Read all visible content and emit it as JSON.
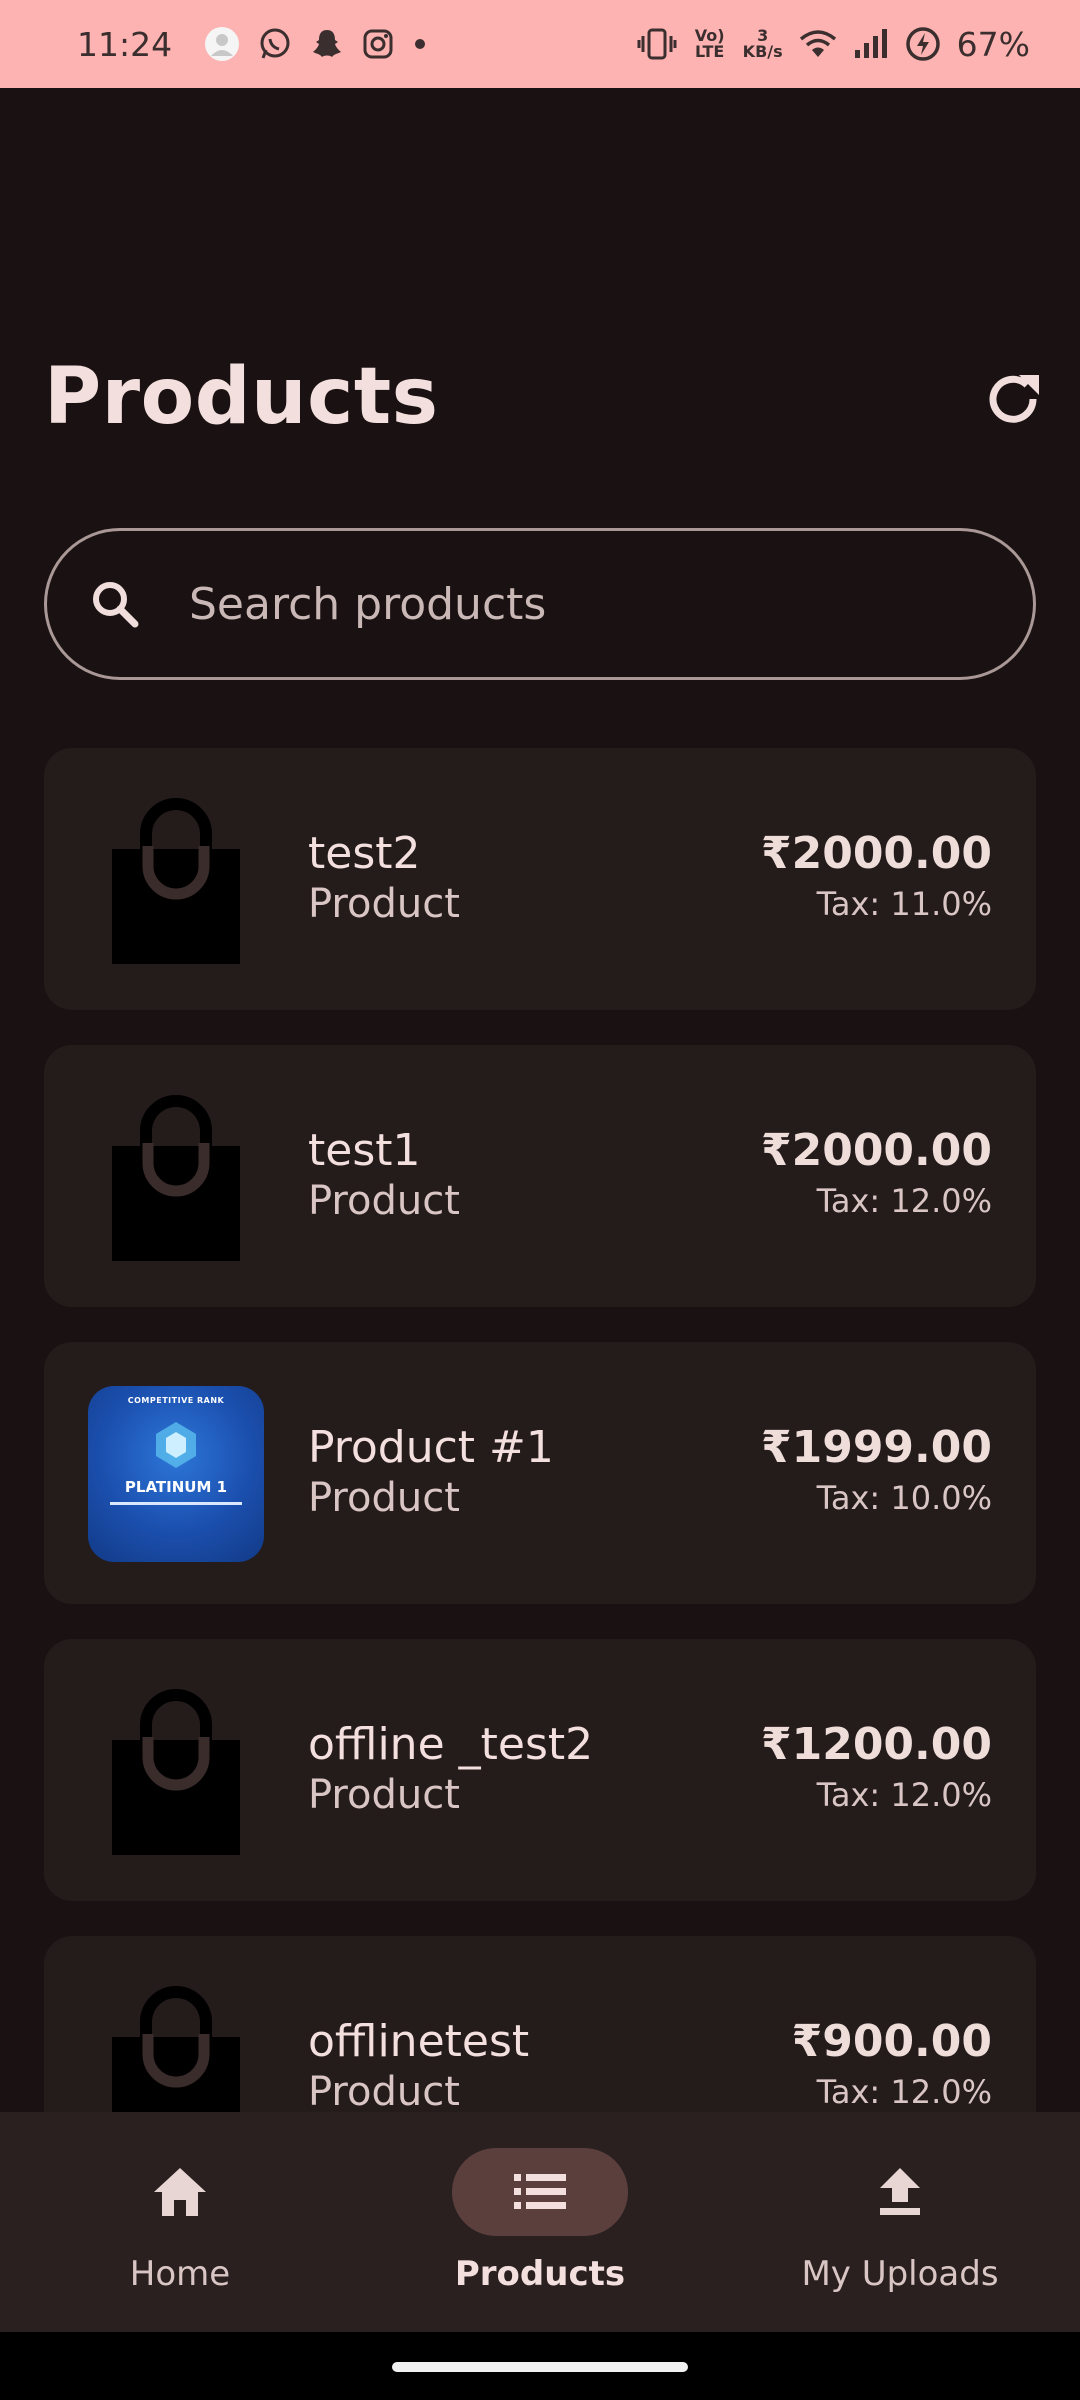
{
  "status_bar": {
    "time": "11:24",
    "network_speed_top": "3",
    "network_speed_unit": "KB/s",
    "volte_label": "Vo) LTE",
    "battery": "67%",
    "icons": [
      "avatar-icon",
      "whatsapp-icon",
      "snapchat-icon",
      "instagram-icon",
      "dot-icon",
      "vibrate-icon",
      "volte-icon",
      "wifi-icon",
      "signal-icon",
      "battery-icon"
    ]
  },
  "header": {
    "title": "Products",
    "refresh_icon": "refresh-icon"
  },
  "search": {
    "placeholder": "Search products",
    "value": ""
  },
  "products": [
    {
      "name": "test2",
      "type": "Product",
      "price": "₹2000.00",
      "tax": "Tax: 11.0%",
      "image": "shopping-bag-icon"
    },
    {
      "name": "test1",
      "type": "Product",
      "price": "₹2000.00",
      "tax": "Tax: 12.0%",
      "image": "shopping-bag-icon"
    },
    {
      "name": "Product #1",
      "type": "Product",
      "price": "₹1999.00",
      "tax": "Tax: 10.0%",
      "image": "product-photo",
      "photo_text": "PLATINUM 1",
      "photo_caption": "COMPETITIVE RANK"
    },
    {
      "name": "offline _test2",
      "type": "Product",
      "price": "₹1200.00",
      "tax": "Tax: 12.0%",
      "image": "shopping-bag-icon"
    },
    {
      "name": "offlinetest",
      "type": "Product",
      "price": "₹900.00",
      "tax": "Tax: 12.0%",
      "image": "shopping-bag-icon"
    }
  ],
  "bottom_nav": {
    "items": [
      {
        "label": "Home",
        "icon": "home-icon",
        "active": false
      },
      {
        "label": "Products",
        "icon": "list-icon",
        "active": true
      },
      {
        "label": "My Uploads",
        "icon": "upload-icon",
        "active": false
      }
    ]
  },
  "colors": {
    "background": "#1a1212",
    "card": "#241b1b",
    "status_bar": "#fdb3b1",
    "nav_active_pill": "#5b3f3d",
    "text": "#f3dfdd"
  }
}
